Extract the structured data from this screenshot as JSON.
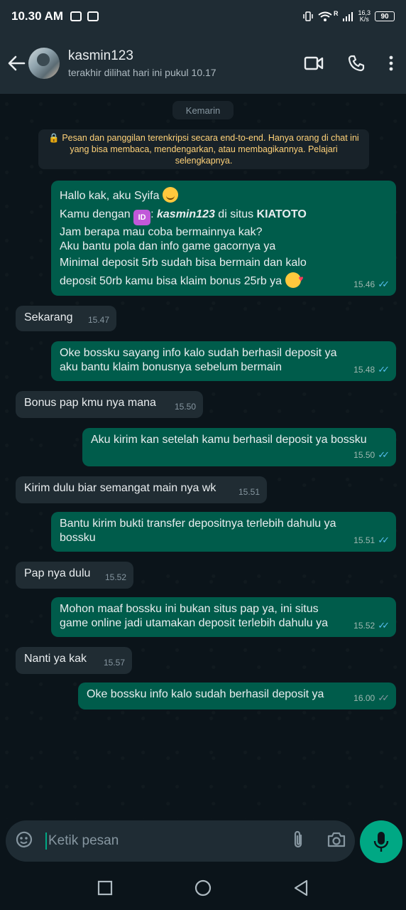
{
  "status_bar": {
    "time": "10.30 AM",
    "battery": "90",
    "net_speed_top": "16,3",
    "net_speed_bottom": "K/s",
    "signal_r": "R"
  },
  "header": {
    "contact_name": "kasmin123",
    "last_seen": "terakhir dilihat hari ini pukul 10.17",
    "icons": [
      "back-arrow-icon",
      "video-call-icon",
      "phone-icon",
      "more-vert-icon"
    ]
  },
  "chat": {
    "date_label": "Kemarin",
    "encryption_notice": "🔒 Pesan dan panggilan terenkripsi secara end-to-end. Hanya orang di chat ini yang bisa membaca, mendengarkan, atau membagikannya. Pelajari selengkapnya.",
    "first_message": {
      "line1": "Hallo kak, aku Syifa",
      "line2_prefix": "Kamu dengan",
      "id_badge": "ID",
      "colon": ":",
      "username": "kasmin123",
      "line2_mid": "di situs",
      "site": "KIATOTO",
      "line3": "Jam berapa mau coba bermainnya kak?",
      "line4": "Aku bantu pola dan info game gacornya ya",
      "line5": "Minimal deposit 5rb sudah bisa bermain dan kalo deposit 50rb kamu bisa klaim bonus 25rb ya",
      "time": "15.46"
    },
    "messages": [
      {
        "dir": "in",
        "text": "Sekarang",
        "time": "15.47"
      },
      {
        "dir": "out",
        "text": "Oke bossku sayang info kalo sudah berhasil deposit ya aku bantu klaim bonusnya sebelum bermain",
        "time": "15.48"
      },
      {
        "dir": "in",
        "text": "Bonus pap kmu nya mana",
        "time": "15.50"
      },
      {
        "dir": "out",
        "text": "Aku kirim kan setelah kamu berhasil deposit ya bossku",
        "time": "15.50"
      },
      {
        "dir": "in",
        "text": "Kirim dulu biar semangat main nya wk",
        "time": "15.51"
      },
      {
        "dir": "out",
        "text": "Bantu kirim bukti transfer depositnya terlebih dahulu ya bossku",
        "time": "15.51"
      },
      {
        "dir": "in",
        "text": "Pap nya dulu",
        "time": "15.52"
      },
      {
        "dir": "out",
        "text": "Mohon maaf bossku ini bukan situs pap ya, ini situs game online jadi utamakan deposit terlebih dahulu ya",
        "time": "15.52"
      },
      {
        "dir": "in",
        "text": "Nanti ya kak",
        "time": "15.57"
      },
      {
        "dir": "out",
        "text": "Oke bossku info kalo sudah berhasil deposit ya",
        "time": "16.00"
      }
    ]
  },
  "composer": {
    "placeholder": "Ketik pesan",
    "icons": [
      "sticker-icon",
      "attach-icon",
      "camera-icon",
      "mic-icon"
    ]
  },
  "nav_bar": {
    "icons": [
      "recents-icon",
      "home-icon",
      "back-icon"
    ]
  },
  "colors": {
    "outgoing_bubble": "#005c4b",
    "incoming_bubble": "#202c33",
    "accent": "#00a884",
    "read_ticks": "#53bdeb"
  }
}
